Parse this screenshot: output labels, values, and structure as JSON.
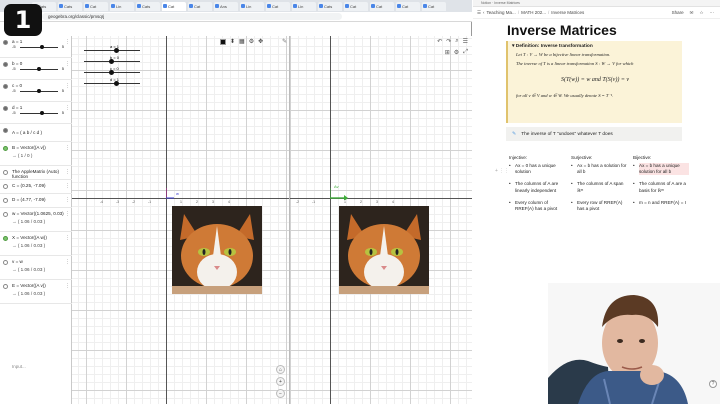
{
  "badge": {
    "number": "1"
  },
  "left_browser": {
    "tabs": [
      "Cats",
      "Cats",
      "Cat",
      "Lin",
      "Cats",
      "Cat",
      "Cat",
      "Ans",
      "Lin",
      "Cat",
      "Lin",
      "Cats",
      "Cat",
      "Cat",
      "Cat",
      "Cat"
    ],
    "url": "geogebra.org/classic/pmsqrj"
  },
  "algebra": {
    "sliders": [
      {
        "name": "a = 1",
        "min": "-5",
        "max": "5",
        "level": 0.6
      },
      {
        "name": "b = 0",
        "min": "-5",
        "max": "5",
        "level": 0.5
      },
      {
        "name": "c = 0",
        "min": "-5",
        "max": "5",
        "level": 0.5
      },
      {
        "name": "d = 1",
        "min": "-5",
        "max": "5",
        "level": 0.6
      }
    ],
    "matrix_label": "A =",
    "matrix_value": "( a  b / c  d )",
    "rows": [
      {
        "label": "B = Vector((A v))",
        "sub": "→ ( 1 / 0 )"
      },
      {
        "label": "The AppleMatrix (Auto) function",
        "sub": ""
      },
      {
        "label": "C = (0.25, -7.09)",
        "sub": ""
      },
      {
        "label": "D = (4.77, -7.09)",
        "sub": ""
      },
      {
        "label": "w = Vector((1.0625, 0.03)",
        "sub": "→ ( 1.06 / 0.03 )"
      },
      {
        "label": "X = Vector((A w))",
        "sub": "→ ( 1.06 / 0.03 )"
      },
      {
        "label": "v = w",
        "sub": "→ ( 1.06 / 0.03 )"
      },
      {
        "label": "E = Vector((A v))",
        "sub": "→ ( 1.06 / 0.03 )"
      }
    ],
    "input_placeholder": "Input..."
  },
  "graphics1": {
    "slider_labels": [
      "a = 1",
      "b = 0",
      "c = 0",
      "d = 1"
    ],
    "slider_levels": [
      0.6,
      0.5,
      0.5,
      0.6
    ],
    "x_ticks": [
      "-4",
      "-3",
      "-2",
      "-1",
      "1",
      "2",
      "3",
      "4"
    ],
    "vector_label": "w"
  },
  "graphics2": {
    "x_ticks": [
      "-4",
      "-3",
      "-2",
      "-1",
      "1",
      "2",
      "3",
      "4"
    ],
    "vector_label": "Av"
  },
  "notes": {
    "window_title": "Notion · Inverse Matrices",
    "breadcrumb": [
      "Teaching Ma...",
      "MATH 202...",
      "Inverse Matrices"
    ],
    "share_label": "Share",
    "title": "Inverse Matrices",
    "definition_heading": "Definition: Inverse transformation",
    "def_line1": "Let T : V → W be a bijective linear transformation.",
    "def_line2": "The inverse of T is a linear transformation S : W → V for which",
    "def_display": "S(T(w)) = w        and        T(S(v)) = v",
    "def_line3": "for all v ∈ V and w ∈ W. We usually denote S = T⁻¹.",
    "callout": "The inverse of T \"undoes\" whatever T does",
    "columns": [
      {
        "heading": "Injective:",
        "items": [
          "Ax = 0 has a unique solution",
          "The columns of A are linearly independent",
          "Every column of RREF(A) has a pivot"
        ]
      },
      {
        "heading": "Surjective:",
        "items": [
          "Ax = b has a solution for all b",
          "The columns of A span ℝᵐ",
          "Every row of RREF(A) has a pivot"
        ]
      },
      {
        "heading": "Bijective:",
        "items": [
          "Ax = b has a unique solution for all b",
          "The columns of A are a basis for ℝᵐ",
          "m = n and RREF(A) = I"
        ]
      }
    ]
  },
  "colors": {
    "accent_blue": "#4a86e8",
    "definition_bg": "#fbf3d8",
    "highlight_red": "#fbe3e3",
    "vector_green": "#3fae3a",
    "vector_purple": "#b0308f"
  }
}
